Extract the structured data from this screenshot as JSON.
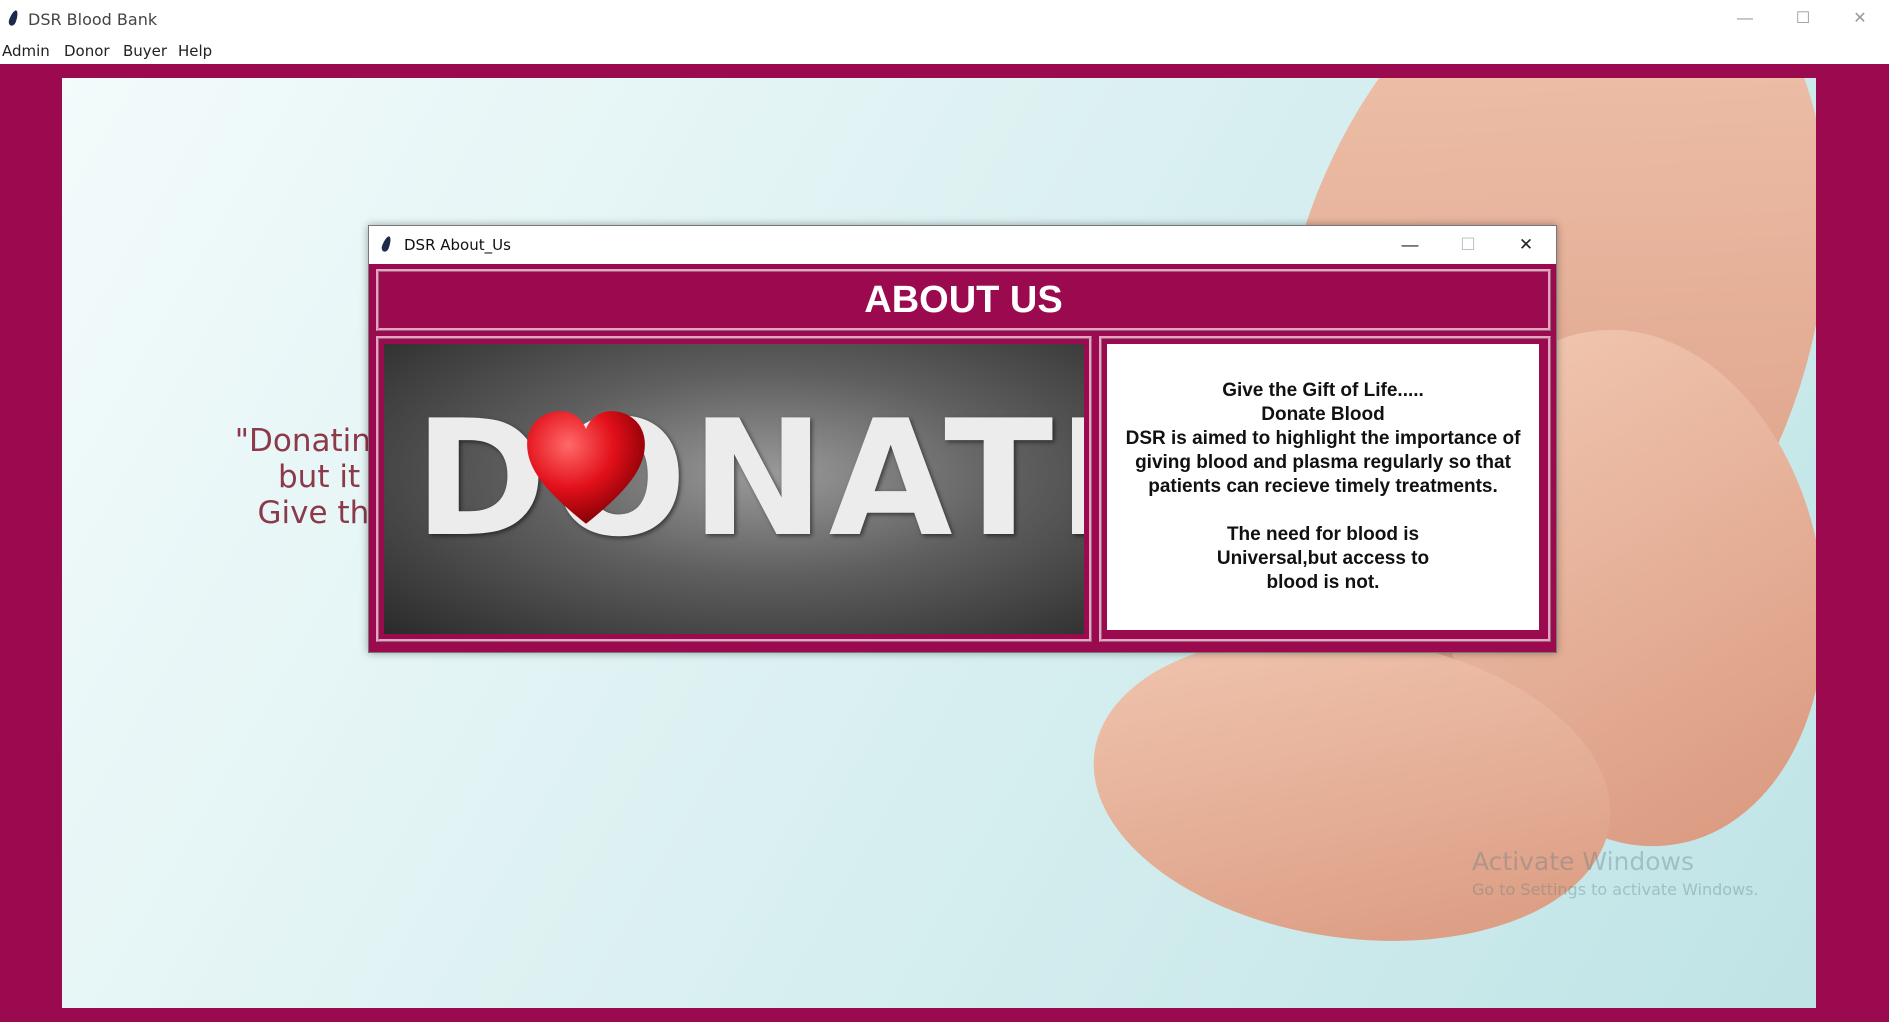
{
  "app": {
    "title": "DSR Blood Bank",
    "controls": {
      "minimize": "—",
      "maximize": "☐",
      "close": "✕"
    }
  },
  "menu": [
    "Admin",
    "Donor",
    "Buyer",
    "Help"
  ],
  "background": {
    "quote_lines": [
      "\"Donating Blo",
      "but it ca",
      "Give the gi"
    ]
  },
  "watermark": {
    "title": "Activate Windows",
    "subtitle": "Go to Settings to activate Windows."
  },
  "dialog": {
    "title": "DSR About_Us",
    "controls": {
      "minimize": "—",
      "maximize": "☐",
      "close": "✕"
    },
    "header": "ABOUT US",
    "image_word": "DONATE",
    "about_lines": [
      "Give the Gift of Life.....",
      "Donate Blood",
      "DSR is aimed to highlight the importance of",
      "giving blood and plasma regularly so that",
      "patients can recieve timely treatments.",
      "",
      "The need for blood is",
      "Universal,but access to",
      "blood is not."
    ]
  },
  "colors": {
    "brand": "#9b0a4f",
    "border": "#e8a3c3"
  }
}
